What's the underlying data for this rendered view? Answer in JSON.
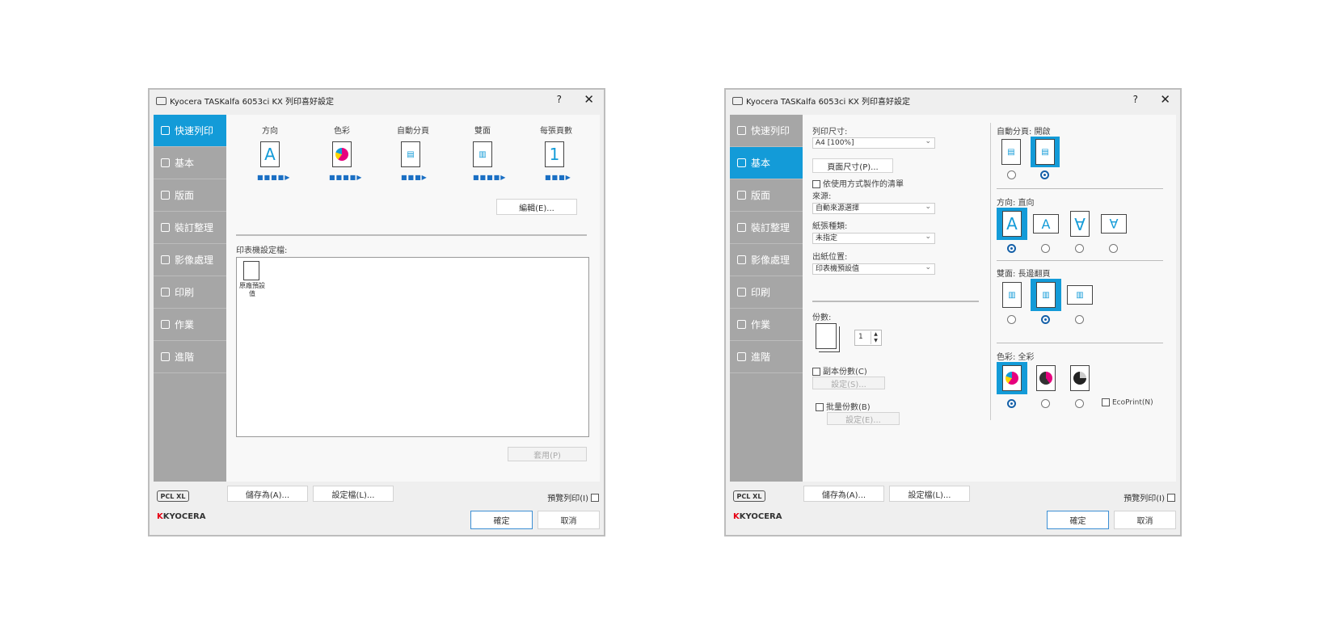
{
  "left": {
    "title": "Kyocera TASKalfa 6053ci KX 列印喜好設定",
    "help": "?",
    "sidebar": [
      "快速列印",
      "基本",
      "版面",
      "裝訂整理",
      "影像處理",
      "印刷",
      "作業",
      "進階"
    ],
    "tiles": [
      {
        "label": "方向"
      },
      {
        "label": "色彩"
      },
      {
        "label": "自動分頁"
      },
      {
        "label": "雙面"
      },
      {
        "label": "每張頁數"
      }
    ],
    "tile_glyph_a": "A",
    "tile_glyph_1": "1",
    "edit_button": "編輯(E)...",
    "profiles_label": "印表機設定檔:",
    "profile_item": "原廠預設值",
    "apply_button": "套用(P)",
    "pcl": "PCL XL",
    "save_as": "儲存為(A)...",
    "profiles_button": "設定檔(L)...",
    "preview": "預覽列印(I)",
    "logo_mark": "K",
    "logo": "KYOCERA",
    "ok": "確定",
    "cancel": "取消"
  },
  "right": {
    "title": "Kyocera TASKalfa 6053ci KX 列印喜好設定",
    "help": "?",
    "sidebar": [
      "快速列印",
      "基本",
      "版面",
      "裝訂整理",
      "影像處理",
      "印刷",
      "作業",
      "進階"
    ],
    "print_size_label": "列印尺寸:",
    "print_size_value": "A4 [100%]",
    "page_size_button": "頁面尺寸(P)...",
    "use_with_app": "依使用方式製作的清單",
    "source_label": "來源:",
    "source_value": "自動來源選擇",
    "media_label": "紙張種類:",
    "media_value": "未指定",
    "output_label": "出紙位置:",
    "output_value": "印表機預設值",
    "copies_label": "份數:",
    "copies_value": "1",
    "copy_count": "副本份數(C)",
    "copy_settings": "設定(S)...",
    "batch": "批量份數(B)",
    "batch_settings": "設定(E)...",
    "collate_label": "自動分頁: 開啟",
    "orientation_label": "方向: 直向",
    "orientation_glyph": "A",
    "duplex_label": "雙面: 長邊翻頁",
    "color_label": "色彩: 全彩",
    "ecoprint": "EcoPrint(N)",
    "pcl": "PCL XL",
    "save_as": "儲存為(A)...",
    "profiles_button": "設定檔(L)...",
    "preview": "預覽列印(I)",
    "logo_mark": "K",
    "logo": "KYOCERA",
    "ok": "確定",
    "cancel": "取消"
  },
  "colors": {
    "accent": "#139bd8",
    "sidebar": "#a6a6a6",
    "brand": "#e60012"
  }
}
